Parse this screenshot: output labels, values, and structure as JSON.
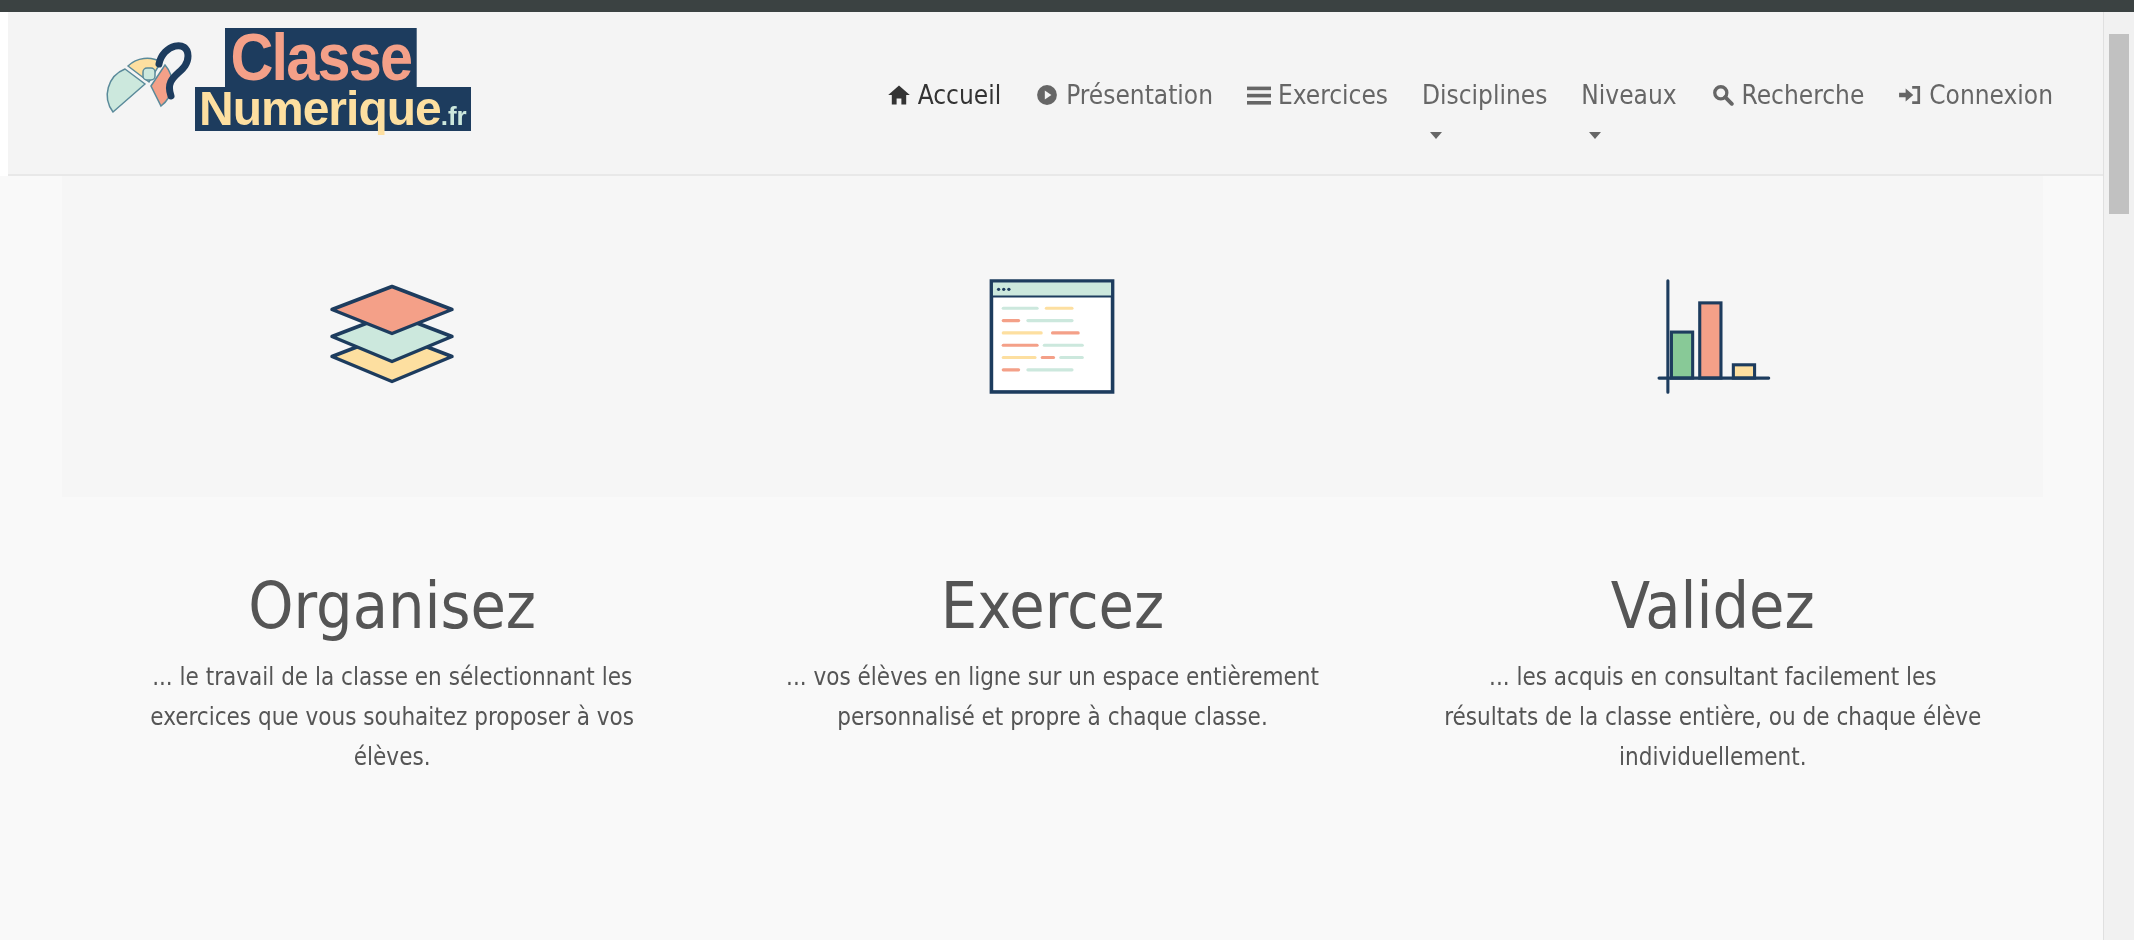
{
  "logo": {
    "line1": "Classe",
    "line2": "Numerique",
    ".fr": ".fr"
  },
  "nav": [
    {
      "label": "Accueil",
      "selected": true,
      "kind": "link"
    },
    {
      "label": "Présentation",
      "selected": false,
      "kind": "link"
    },
    {
      "label": "Exercices",
      "selected": false,
      "kind": "link"
    },
    {
      "label": "Disciplines",
      "selected": false,
      "kind": "dropdown"
    },
    {
      "label": "Niveaux",
      "selected": false,
      "kind": "dropdown"
    },
    {
      "label": "Recherche",
      "selected": false,
      "kind": "link"
    },
    {
      "label": "Connexion",
      "selected": false,
      "kind": "link"
    }
  ],
  "features": [
    {
      "title": "Organisez",
      "text": "... le travail de la classe en sélectionnant les exercices que vous souhaitez proposer à vos élèves."
    },
    {
      "title": "Exercez",
      "text": "... vos élèves en ligne sur un espace entièrement personnalisé et propre à chaque classe."
    },
    {
      "title": "Validez",
      "text": "... les acquis en consultant facilement les résultats de la classe entière, ou de chaque élève individuellement."
    }
  ]
}
